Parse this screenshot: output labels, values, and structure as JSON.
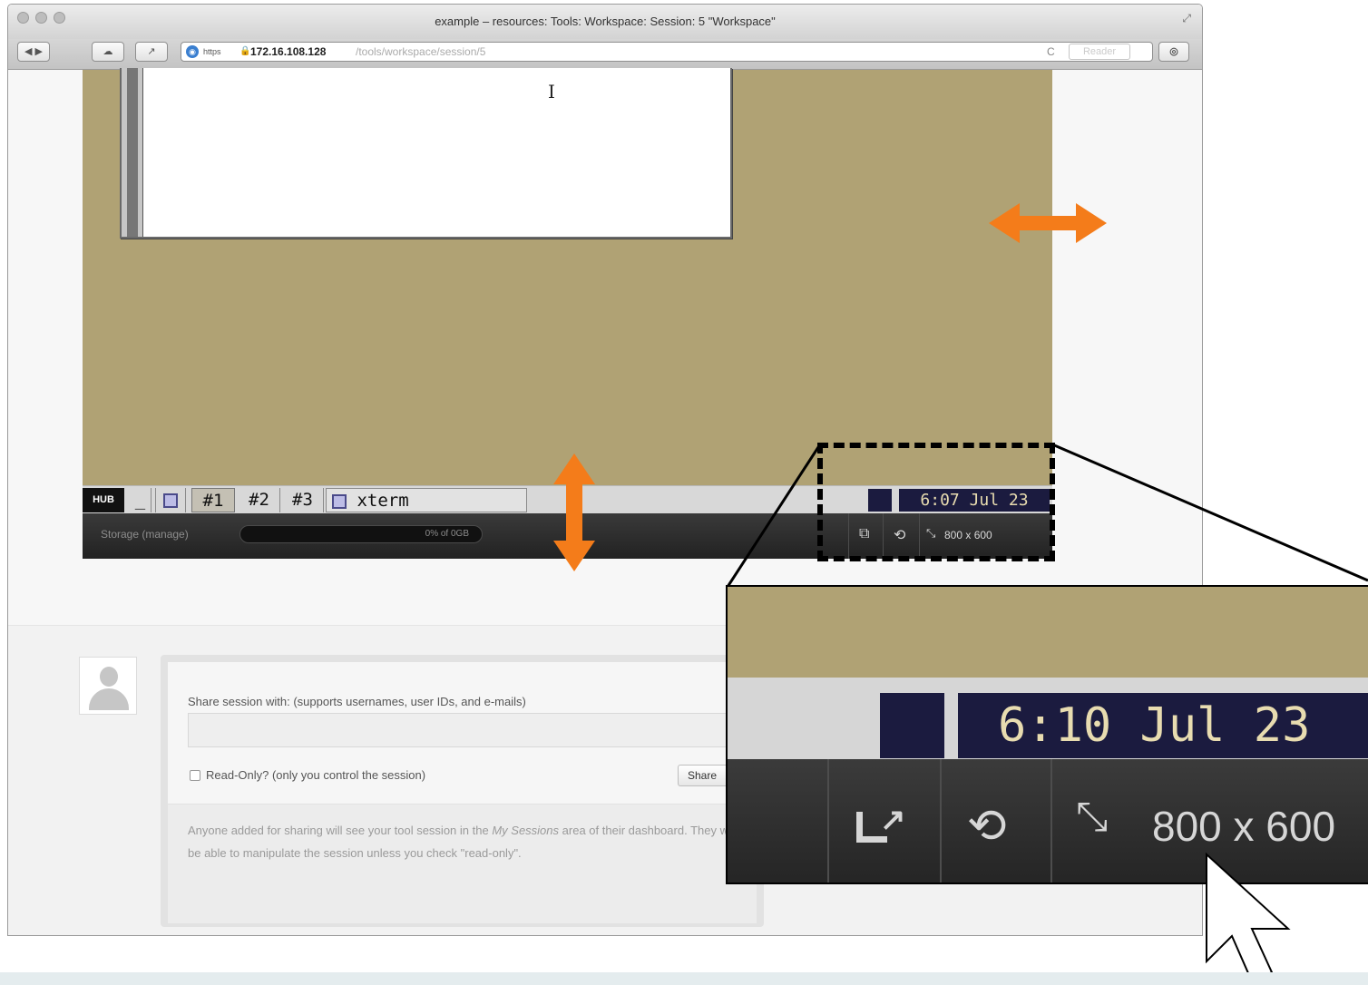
{
  "window": {
    "title": "example – resources: Tools: Workspace: Session: 5 \"Workspace\"",
    "url": {
      "scheme": "https",
      "lock": "🔒",
      "host": "172.16.108.128",
      "path": "/tools/workspace/session/5"
    },
    "reader_label": "Reader",
    "reload_icon": "C"
  },
  "taskbar": {
    "logo": "HUB",
    "minimize": "_",
    "workspaces": [
      "#1",
      "#2",
      "#3"
    ],
    "active_workspace": "#1",
    "window_label": "xterm",
    "clock": "6:07 Jul 23"
  },
  "statusbar": {
    "storage_label": "Storage (manage)",
    "storage_text": "0% of 0GB",
    "storage_percent": 0,
    "screen_size": "800 x 600"
  },
  "share": {
    "label": "Share session with: (supports usernames, user IDs, and e-mails)",
    "input_value": "",
    "readonly_label": "Read-Only? (only you control the session)",
    "readonly_checked": false,
    "button_label": "Share",
    "note_before": "Anyone added for sharing will see your tool session in the",
    "note_emphasis": "My Sessions",
    "note_after": "area of their dashboard. They will be able to manipulate the session unless you check \"read-only\"."
  },
  "zoom": {
    "clock": "6:10 Jul 23",
    "screen_size": "800 x 600"
  },
  "colors": {
    "desktop": "#b0a274",
    "clock_bg": "#1b1b3f",
    "clock_text": "#e8dcb0",
    "arrow": "#f47c1a"
  }
}
